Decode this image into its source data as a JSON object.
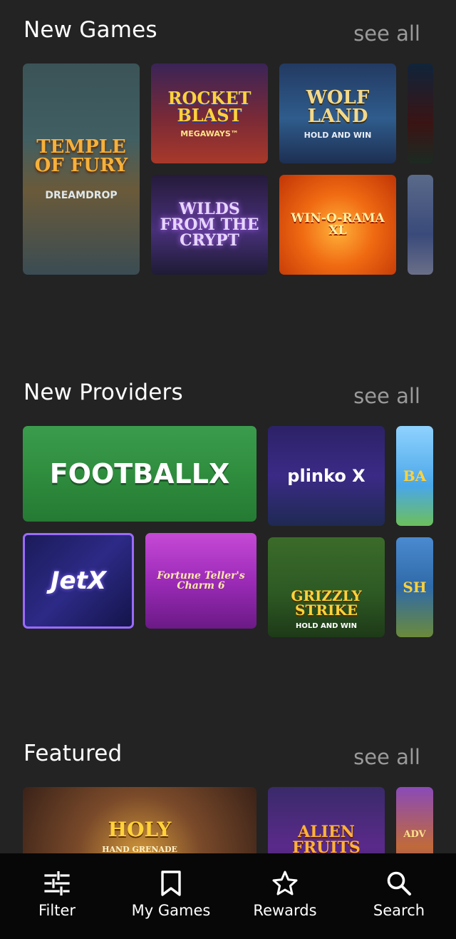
{
  "sections": {
    "new_games": {
      "title": "New Games",
      "see_all": "see all",
      "tiles": [
        {
          "label": "TEMPLE OF FURY",
          "sub": "DREAMDROP"
        },
        {
          "label": "ROCKET BLAST",
          "sub": "MEGAWAYS™"
        },
        {
          "label": "WOLF LAND",
          "sub": "HOLD AND WIN"
        },
        {
          "label": "WILDS FROM THE CRYPT",
          "sub": ""
        },
        {
          "label": "WIN-O-RAMA XL",
          "sub": ""
        },
        {
          "label": "",
          "sub": ""
        },
        {
          "label": "",
          "sub": ""
        }
      ]
    },
    "new_providers": {
      "title": "New Providers",
      "see_all": "see all",
      "tiles": [
        {
          "label": "FOOTBALLX",
          "sub": ""
        },
        {
          "label": "plinko X",
          "sub": ""
        },
        {
          "label": "BA",
          "sub": ""
        },
        {
          "label": "JetX",
          "sub": ""
        },
        {
          "label": "Fortune Teller's Charm 6",
          "sub": ""
        },
        {
          "label": "GRIZZLY STRIKE",
          "sub": "HOLD AND WIN"
        },
        {
          "label": "SH",
          "sub": ""
        }
      ]
    },
    "featured": {
      "title": "Featured",
      "see_all": "see all",
      "tiles": [
        {
          "label": "HOLY",
          "sub": "HAND GRENADE"
        },
        {
          "label": "ALIEN FRUITS",
          "sub": ""
        },
        {
          "label": "ADV",
          "sub": ""
        }
      ]
    }
  },
  "bottom_nav": {
    "items": [
      {
        "label": "Filter",
        "icon": "filter-sliders-icon"
      },
      {
        "label": "My Games",
        "icon": "bookmark-icon"
      },
      {
        "label": "Rewards",
        "icon": "star-icon"
      },
      {
        "label": "Search",
        "icon": "search-icon"
      }
    ]
  },
  "colors": {
    "background": "#232323",
    "nav_background": "#070707",
    "see_all": "#9a9a9a"
  }
}
